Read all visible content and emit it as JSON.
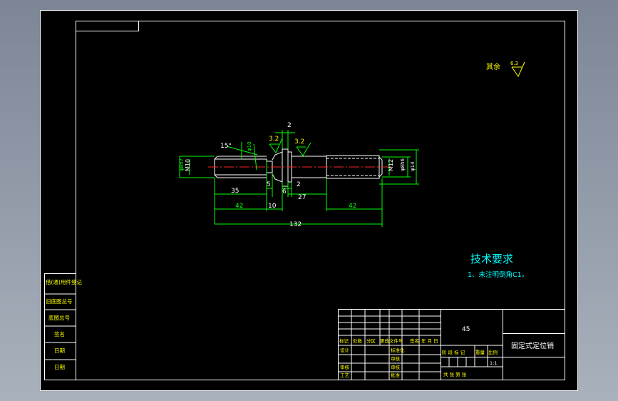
{
  "surface_note": {
    "label": "其余",
    "roughness": "6.3"
  },
  "part_dims": {
    "chamfer_angle": "15°",
    "roughness_left": "3.2",
    "roughness_right": "3.2",
    "top_width": "2",
    "dia_left_fit": "φ8h7",
    "thread_left": "M10",
    "small_dia": "φ10",
    "thread_right": "M12",
    "dia_right_fit": "φ8h6",
    "dia_right_outer": "φ14",
    "len_thread_left": "35",
    "len_5": "5",
    "len_6": "6",
    "len_2": "2",
    "len_27": "27",
    "len_42_left": "42",
    "len_10": "10",
    "len_42_right": "42",
    "len_total": "132"
  },
  "tech_requirements": {
    "title": "技术要求",
    "item1": "1、未注明倒角C1。"
  },
  "left_strip": [
    "借(通)用件登记",
    "旧底图总号",
    "底图总号",
    "签名",
    "日期",
    "日期"
  ],
  "title_block": {
    "material": "45",
    "part_name": "固定式定位销",
    "rev_header": [
      "标记",
      "处数",
      "分区",
      "更改文件号",
      "签名",
      "年 月 日"
    ],
    "design": "设计",
    "standardize": "标准化",
    "check": "审核",
    "craft": "工艺",
    "review": "审核",
    "approve": "批准",
    "stage_headers": [
      "阶 段 标 记",
      "重量",
      "比例"
    ],
    "scale": "1:1",
    "sheets": "共    张    第    张"
  }
}
